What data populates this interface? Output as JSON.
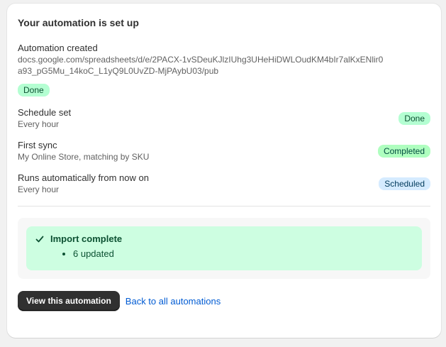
{
  "card": {
    "title": "Your automation is set up"
  },
  "steps": {
    "created": {
      "title": "Automation created",
      "url": "docs.google.com/spreadsheets/d/e/2PACX-1vSDeuKJlzIUhg3UHeHiDWLOudKM4bIr7alKxENlir0a93_pG5Mu_14koC_L1yQ9L0UvZD-MjPAybU03/pub",
      "badge": "Done"
    },
    "schedule": {
      "title": "Schedule set",
      "subtitle": "Every hour",
      "badge": "Done"
    },
    "first_sync": {
      "title": "First sync",
      "subtitle": "My Online Store, matching by SKU",
      "badge": "Completed"
    },
    "runs": {
      "title": "Runs automatically from now on",
      "subtitle": "Every hour",
      "badge": "Scheduled"
    }
  },
  "result": {
    "title": "Import complete",
    "items": [
      "6 updated"
    ]
  },
  "actions": {
    "primary_label": "View this automation",
    "link_label": "Back to all automations"
  },
  "colors": {
    "done_badge": "#b4fed2",
    "completed_badge": "#affebf",
    "scheduled_badge": "#d5ebff",
    "banner_bg": "#cdfee1",
    "primary_button": "#303030",
    "link": "#005bd3"
  },
  "icons": {
    "banner": "check-icon"
  }
}
